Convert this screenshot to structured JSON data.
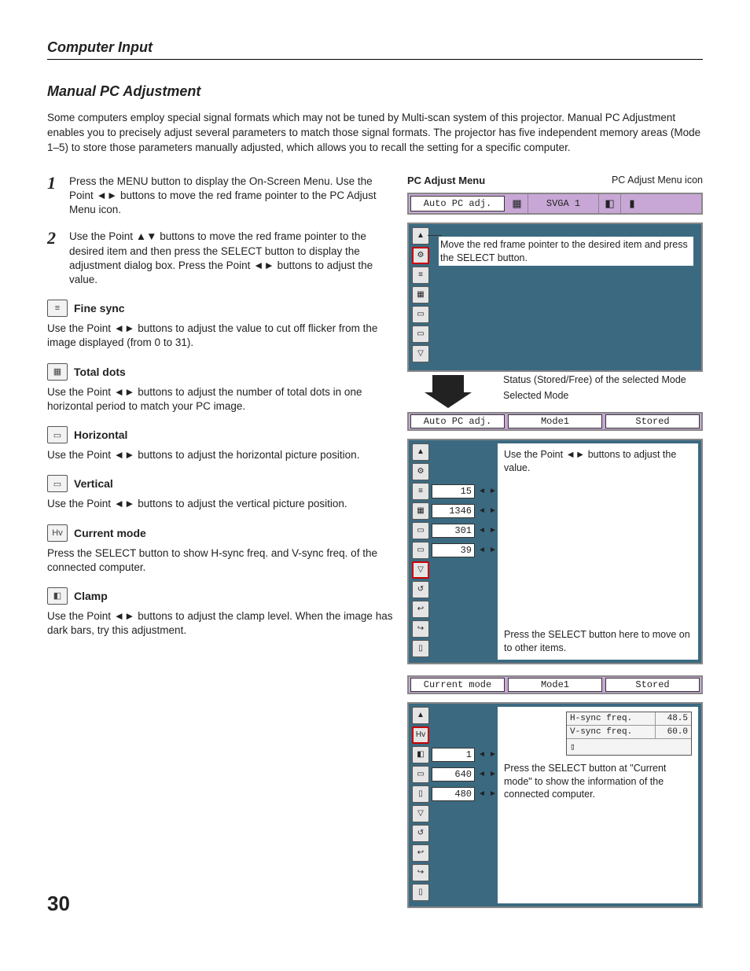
{
  "header": {
    "section": "Computer Input",
    "subsection": "Manual PC Adjustment"
  },
  "intro": "Some computers employ special signal formats which may not be tuned by Multi-scan system of this projector. Manual PC Adjustment enables you to precisely adjust several parameters to match those signal formats. The projector has five independent memory areas (Mode 1–5) to store those parameters manually adjusted, which allows you to recall the setting for a specific computer.",
  "steps": [
    {
      "num": "1",
      "text": "Press the MENU button to display the On-Screen Menu. Use the Point ◄► buttons to move the red frame pointer to the PC Adjust Menu icon."
    },
    {
      "num": "2",
      "text": "Use the Point ▲▼ buttons to move the red frame pointer to the desired item and then press the SELECT button to display the adjustment dialog box. Press the Point ◄► buttons to adjust the value."
    }
  ],
  "settings": [
    {
      "icon": "≡",
      "name": "Fine sync",
      "text": "Use the Point ◄► buttons to adjust the value to cut off flicker from the image displayed (from 0 to 31)."
    },
    {
      "icon": "▦",
      "name": "Total dots",
      "text": "Use the Point ◄► buttons to adjust the number of total dots in one horizontal period to match your PC image."
    },
    {
      "icon": "▭",
      "name": "Horizontal",
      "text": "Use the Point ◄► buttons to adjust the horizontal picture position."
    },
    {
      "icon": "▭",
      "name": "Vertical",
      "text": "Use the Point ◄► buttons to adjust the vertical picture position."
    },
    {
      "icon": "Hv",
      "name": "Current mode",
      "text": "Press the SELECT button to show H-sync freq. and V-sync freq. of the connected computer."
    },
    {
      "icon": "◧",
      "name": "Clamp",
      "text": "Use the Point ◄► buttons to adjust the clamp level. When the image has dark bars, try this adjustment."
    }
  ],
  "right": {
    "menu_title": "PC Adjust Menu",
    "icon_note": "PC Adjust Menu icon",
    "topbar": {
      "auto": "Auto PC adj.",
      "svga": "SVGA 1"
    },
    "panel1_note": "Move the red frame pointer to the desired item and press the SELECT button.",
    "status_labels": {
      "selected_mode": "Selected Mode",
      "status_of_mode": "Status (Stored/Free) of the selected Mode"
    },
    "statusbar1": {
      "a": "Auto PC adj.",
      "b": "Mode1",
      "c": "Stored"
    },
    "panel2_note_top": "Use the Point ◄► buttons to adjust the value.",
    "panel2_vals": [
      "15",
      "1346",
      "301",
      "39"
    ],
    "panel2_note_bottom": "Press the SELECT button here to move on to other items.",
    "statusbar2": {
      "a": "Current mode",
      "b": "Mode1",
      "c": "Stored"
    },
    "panel3_vals": [
      "",
      "1",
      "640",
      "480"
    ],
    "freq": {
      "h_label": "H-sync freq.",
      "h_val": "48.5",
      "v_label": "V-sync freq.",
      "v_val": "60.0"
    },
    "panel3_note": "Press the SELECT button at  \"Current mode\" to show the information of the connected computer."
  },
  "page": "30"
}
